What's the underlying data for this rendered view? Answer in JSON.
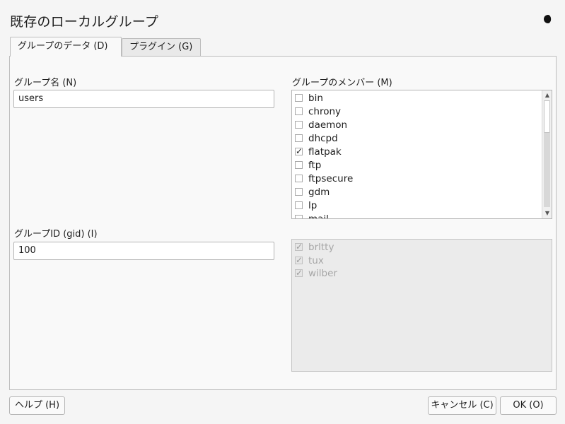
{
  "window": {
    "title": "既存のローカルグループ",
    "theme_icon": "moon-icon"
  },
  "tabs": [
    {
      "label": "グループのデータ (D)",
      "active": true
    },
    {
      "label": "プラグイン (G)",
      "active": false
    }
  ],
  "group_name": {
    "label": "グループ名 (N)",
    "value": "users"
  },
  "group_id": {
    "label": "グループID (gid) (I)",
    "value": "100"
  },
  "members": {
    "label": "グループのメンバー (M)",
    "items": [
      {
        "name": "bin",
        "checked": false
      },
      {
        "name": "chrony",
        "checked": false
      },
      {
        "name": "daemon",
        "checked": false
      },
      {
        "name": "dhcpd",
        "checked": false
      },
      {
        "name": "flatpak",
        "checked": true
      },
      {
        "name": "ftp",
        "checked": false
      },
      {
        "name": "ftpsecure",
        "checked": false
      },
      {
        "name": "gdm",
        "checked": false
      },
      {
        "name": "lp",
        "checked": false
      },
      {
        "name": "mail",
        "checked": false
      }
    ]
  },
  "secondary_members": {
    "items": [
      {
        "name": "brltty",
        "checked": true
      },
      {
        "name": "tux",
        "checked": true
      },
      {
        "name": "wilber",
        "checked": true
      }
    ]
  },
  "buttons": {
    "help": "ヘルプ (H)",
    "cancel": "キャンセル (C)",
    "ok": "OK (O)"
  }
}
